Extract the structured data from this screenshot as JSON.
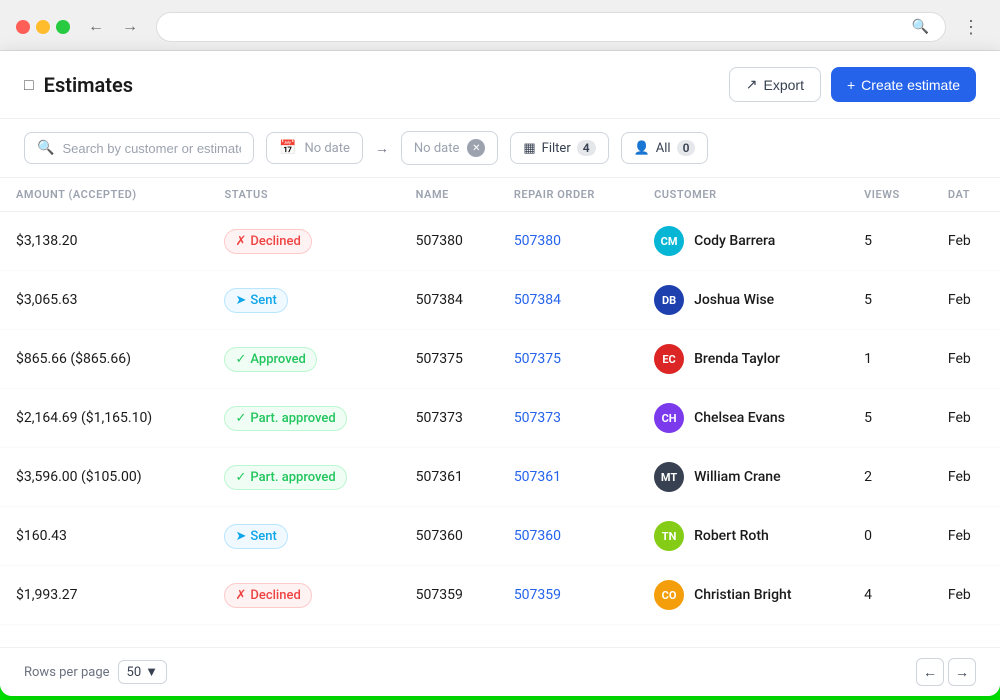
{
  "browser": {
    "url": ""
  },
  "header": {
    "icon": "□",
    "title": "Estimates",
    "export_label": "Export",
    "create_label": "Create estimate"
  },
  "filters": {
    "search_placeholder": "Search by customer or estimate name",
    "no_date_1": "No date",
    "no_date_2": "No date",
    "filter_label": "Filter",
    "filter_count": "4",
    "all_label": "All",
    "all_count": "0"
  },
  "table": {
    "columns": [
      "AMOUNT (ACCEPTED)",
      "STATUS",
      "NAME",
      "REPAIR ORDER",
      "CUSTOMER",
      "VIEWS",
      "DAT"
    ],
    "rows": [
      {
        "amount": "$3,138.20",
        "amount_accepted": "",
        "status": "Declined",
        "status_type": "declined",
        "name": "507380",
        "repair_order": "507380",
        "customer_name": "Cody Barrera",
        "customer_initials": "CM",
        "avatar_color": "#06b6d4",
        "views": "5",
        "date": "Feb"
      },
      {
        "amount": "$3,065.63",
        "amount_accepted": "",
        "status": "Sent",
        "status_type": "sent",
        "name": "507384",
        "repair_order": "507384",
        "customer_name": "Joshua Wise",
        "customer_initials": "DB",
        "avatar_color": "#1e40af",
        "views": "5",
        "date": "Feb"
      },
      {
        "amount": "$865.66 ($865.66)",
        "amount_accepted": "",
        "status": "Approved",
        "status_type": "approved",
        "name": "507375",
        "repair_order": "507375",
        "customer_name": "Brenda Taylor",
        "customer_initials": "EC",
        "avatar_color": "#dc2626",
        "views": "1",
        "date": "Feb"
      },
      {
        "amount": "$2,164.69 ($1,165.10)",
        "amount_accepted": "",
        "status": "Part. approved",
        "status_type": "part-approved",
        "name": "507373",
        "repair_order": "507373",
        "customer_name": "Chelsea Evans",
        "customer_initials": "CH",
        "avatar_color": "#7c3aed",
        "views": "5",
        "date": "Feb"
      },
      {
        "amount": "$3,596.00 ($105.00)",
        "amount_accepted": "",
        "status": "Part. approved",
        "status_type": "part-approved",
        "name": "507361",
        "repair_order": "507361",
        "customer_name": "William Crane",
        "customer_initials": "MT",
        "avatar_color": "#374151",
        "views": "2",
        "date": "Feb"
      },
      {
        "amount": "$160.43",
        "amount_accepted": "",
        "status": "Sent",
        "status_type": "sent",
        "name": "507360",
        "repair_order": "507360",
        "customer_name": "Robert Roth",
        "customer_initials": "TN",
        "avatar_color": "#84cc16",
        "views": "0",
        "date": "Feb"
      },
      {
        "amount": "$1,993.27",
        "amount_accepted": "",
        "status": "Declined",
        "status_type": "declined",
        "name": "507359",
        "repair_order": "507359",
        "customer_name": "Christian Bright",
        "customer_initials": "CO",
        "avatar_color": "#f59e0b",
        "views": "4",
        "date": "Feb"
      }
    ]
  },
  "footer": {
    "rows_per_page_label": "Rows per page",
    "rows_per_page_value": "50"
  }
}
